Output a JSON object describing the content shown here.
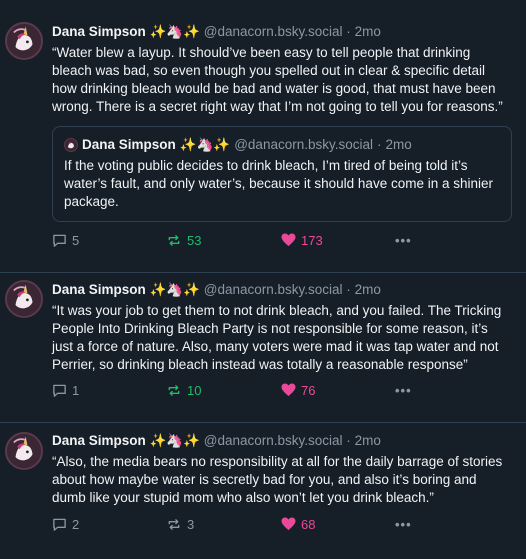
{
  "posts": [
    {
      "author": "Dana Simpson",
      "emoji": "✨🦄✨",
      "handle": "@danacorn.bsky.social",
      "separator": "·",
      "time": "2mo",
      "text": "“Water blew a layup. It should’ve been easy to tell people that drinking bleach was bad, so even though you spelled out in clear & specific detail how drinking bleach would be bad  and water is good, that must have been wrong. There is a secret right way that I’m not going to tell you for reasons.”",
      "quote": {
        "author": "Dana Simpson",
        "emoji": "✨🦄✨",
        "handle": "@danacorn.bsky.social",
        "separator": "·",
        "time": "2mo",
        "text": "If the voting public decides to drink bleach, I’m tired of being told it’s water’s fault, and only water’s, because it should have come in a shinier package."
      },
      "replies": "5",
      "reposts": "53",
      "likes": "173",
      "more": "•••"
    },
    {
      "author": "Dana Simpson",
      "emoji": "✨🦄✨",
      "handle": "@danacorn.bsky.social",
      "separator": "·",
      "time": "2mo",
      "text": "“It was your job to get them to not drink bleach, and you failed. The Tricking People Into Drinking Bleach Party is not responsible for some reason, it’s just a force of nature. Also, many voters were mad it was tap water and not Perrier, so drinking bleach instead was totally a reasonable response”",
      "replies": "1",
      "reposts": "10",
      "likes": "76",
      "more": "•••"
    },
    {
      "author": "Dana Simpson",
      "emoji": "✨🦄✨",
      "handle": "@danacorn.bsky.social",
      "separator": "·",
      "time": "2mo",
      "text": "“Also, the media bears no responsibility at all for the daily barrage of stories about how maybe water is secretly bad for you, and also it’s boring and dumb like your stupid mom who also won’t let you drink bleach.”",
      "replies": "2",
      "reposts": "3",
      "likes": "68",
      "more": "•••"
    }
  ],
  "colors": {
    "background": "#161e27",
    "repost_active": "#20bc6a",
    "like_active": "#ec4899",
    "muted": "#8b98a5",
    "border": "#2e4052"
  },
  "icons": {
    "reply": "speech-bubble-icon",
    "repost": "repost-arrows-icon",
    "like": "heart-icon",
    "more": "ellipsis-icon",
    "avatar": "unicorn-avatar-icon"
  }
}
